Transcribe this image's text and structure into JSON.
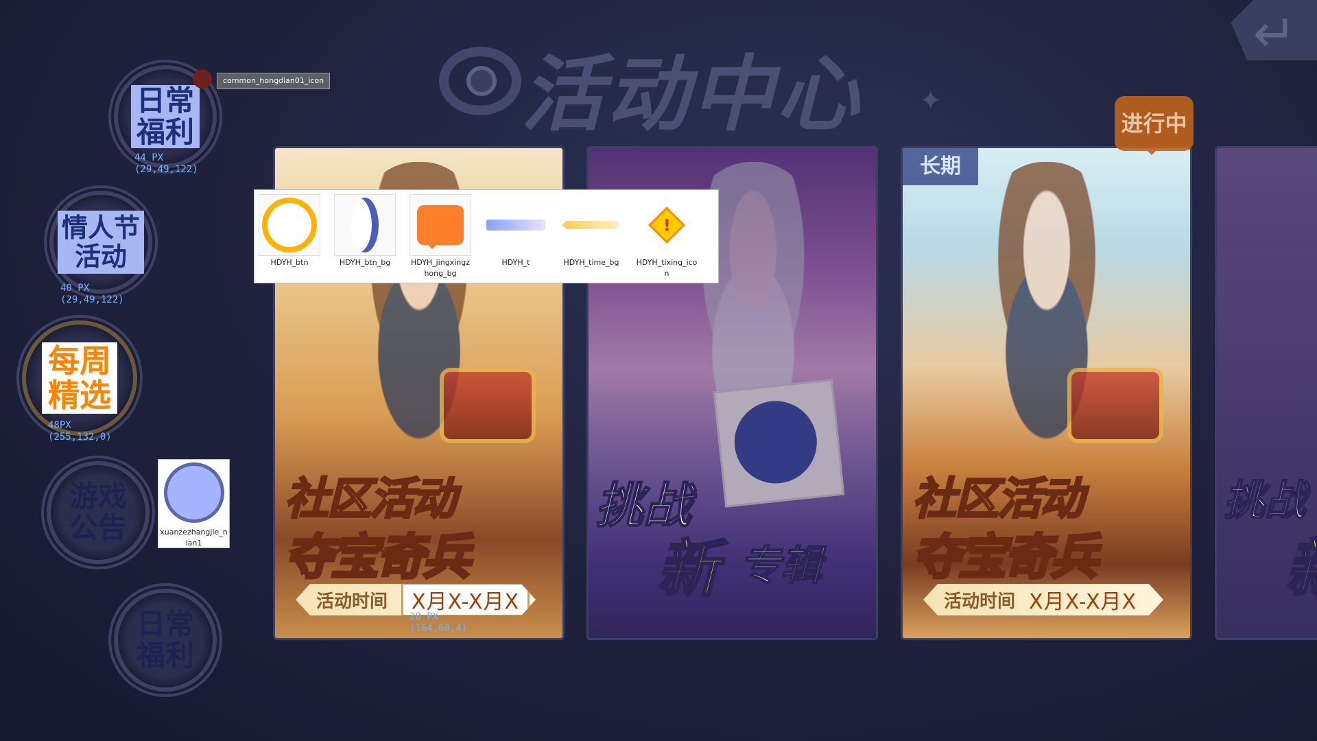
{
  "header": {
    "title": "活动中心"
  },
  "back_button": {
    "icon": "return-arrow-icon",
    "glyph": "↵"
  },
  "nav": [
    {
      "label": "日常\n福利",
      "l1": "日常",
      "l2": "福利",
      "size_note": "44 PX",
      "color_note": "(29,49,122)"
    },
    {
      "label": "情人节活动",
      "l1": "情人节",
      "l2": "活动",
      "size_note": "40 PX",
      "color_note": "(29,49,122)"
    },
    {
      "label": "每周精选",
      "l1": "每周",
      "l2": "精选",
      "size_note": "48PX",
      "color_note": "(255,132,0)"
    },
    {
      "label": "游戏公告",
      "l1": "游戏",
      "l2": "公告"
    },
    {
      "label": "日常福利",
      "l1": "日常",
      "l2": "福利"
    }
  ],
  "badge_annotation": "common_hongdian01_icon",
  "ongoing_tag": "进行中",
  "cards": [
    {
      "line1": "社区活动",
      "line2": "夺宝奇兵",
      "time_label": "活动时间",
      "time_value": "X月X-X月X",
      "size_note": "28 PX",
      "color_note": "(164,60,4)"
    },
    {
      "line1": "挑战",
      "line2": "新",
      "line3": "专辑"
    },
    {
      "tag": "长期",
      "line1": "社区活动",
      "line2": "夺宝奇兵",
      "time_label": "活动时间",
      "time_value": "X月X-X月X"
    },
    {
      "line1": "挑战",
      "line2": "新"
    }
  ],
  "assets": [
    {
      "name": "HDYH_btn"
    },
    {
      "name": "HDYH_btn_bg"
    },
    {
      "name": "HDYH_jingxingzhong_bg"
    },
    {
      "name": "HDYH_t"
    },
    {
      "name": "HDYH_time_bg"
    },
    {
      "name": "HDYH_tixing_icon"
    }
  ],
  "select_asset": {
    "name": "xuanzezhangjie_nian1"
  },
  "colors": {
    "background": "#1f2340",
    "accent_orange": "#ff8400",
    "nav_blue": "#1d317a",
    "time_text": "#a43c04"
  }
}
